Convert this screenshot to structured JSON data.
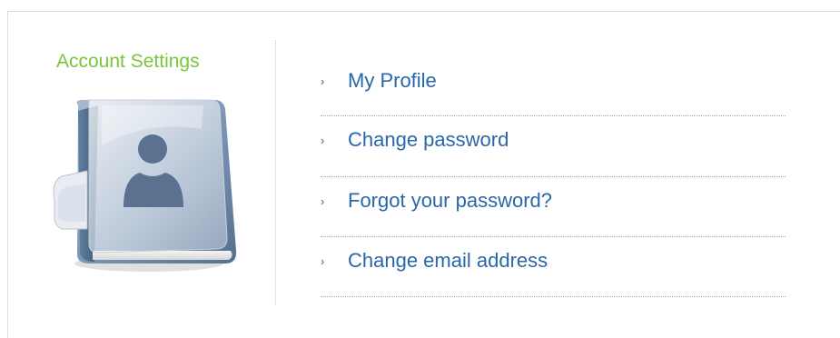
{
  "section": {
    "title": "Account Settings",
    "icon": "account-book-icon"
  },
  "menu": {
    "items": [
      {
        "label": "My Profile",
        "icon": "chevron-right-icon"
      },
      {
        "label": "Change password",
        "icon": "chevron-right-icon"
      },
      {
        "label": "Forgot your password?",
        "icon": "chevron-right-icon"
      },
      {
        "label": "Change email address",
        "icon": "chevron-right-icon"
      }
    ]
  },
  "colors": {
    "title": "#79c63e",
    "link": "#2b67a8",
    "chevron": "#888888",
    "book": "#6f88a6"
  }
}
